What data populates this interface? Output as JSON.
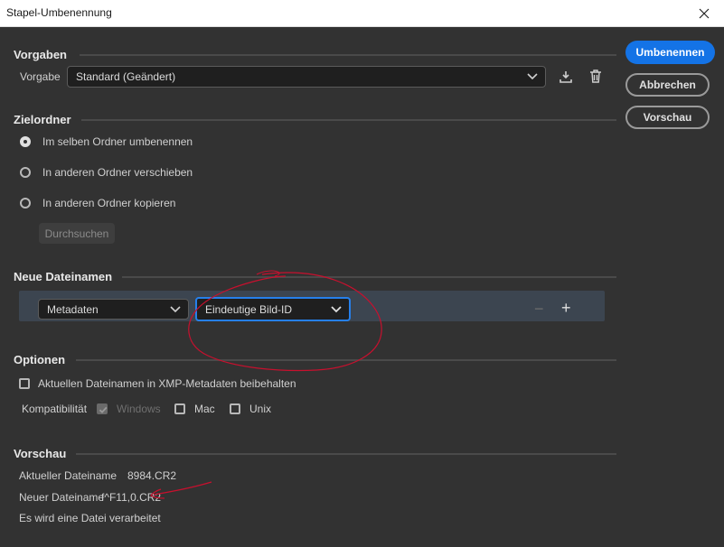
{
  "window": {
    "title": "Stapel-Umbenennung"
  },
  "sections": {
    "presets": "Vorgaben",
    "destination": "Zielordner",
    "new_names": "Neue Dateinamen",
    "options": "Optionen",
    "preview": "Vorschau"
  },
  "preset": {
    "label": "Vorgabe",
    "value": "Standard (Geändert)"
  },
  "destination": {
    "options": [
      {
        "label": "Im selben Ordner umbenennen",
        "checked": true
      },
      {
        "label": "In anderen Ordner verschieben",
        "checked": false
      },
      {
        "label": "In anderen Ordner kopieren",
        "checked": false
      }
    ],
    "browse_label": "Durchsuchen"
  },
  "rename_row": {
    "type_value": "Metadaten",
    "field_value": "Eindeutige Bild-ID",
    "minus": "−",
    "plus": "+"
  },
  "options": {
    "keep_filename_label": "Aktuellen Dateinamen in XMP-Metadaten beibehalten",
    "compat_label": "Kompatibilität",
    "windows_label": "Windows",
    "mac_label": "Mac",
    "unix_label": "Unix"
  },
  "preview": {
    "current_label": "Aktueller Dateiname",
    "current_value": "8984.CR2",
    "new_label": "Neuer Dateiname",
    "new_value": "f^F11,0.CR2",
    "count_text": "Es wird eine Datei verarbeitet"
  },
  "buttons": {
    "rename": "Umbenennen",
    "cancel": "Abbrechen",
    "preview": "Vorschau"
  },
  "icons": {
    "close": "close-icon",
    "save_preset": "download-icon",
    "delete_preset": "trash-icon",
    "chevron": "chevron-down-icon",
    "checkmark": "checkmark-icon"
  },
  "colors": {
    "primary": "#1473e6",
    "focus": "#2680eb",
    "annotation": "#c8102e"
  }
}
